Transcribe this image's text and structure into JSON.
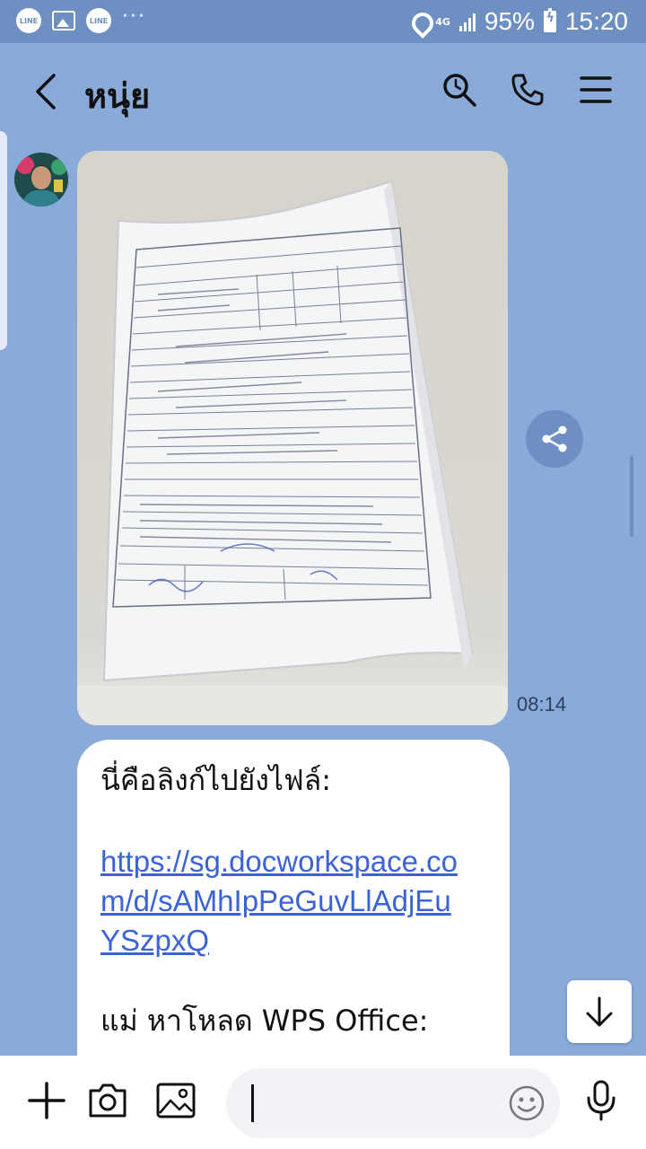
{
  "status_bar": {
    "app_icon_1": "LINE",
    "app_icon_2": "LINE",
    "network": "4G",
    "battery": "95%",
    "time": "15:20"
  },
  "header": {
    "title": "หนุ่ย",
    "icons": [
      "back-icon",
      "search-icon",
      "phone-icon",
      "menu-icon"
    ]
  },
  "messages": [
    {
      "type": "image",
      "sender": "avatar",
      "time": "08:14"
    },
    {
      "type": "text",
      "intro": "นี่คือลิงก์ไปยังไฟล์:",
      "link": "https://sg.docworkspace.com/d/sAMhIpPeGuvLlAdjEuYSzpxQ",
      "footer": "แม่ หาโหลด WPS Office:"
    }
  ],
  "input_bar": {
    "placeholder": "",
    "icons": [
      "plus-icon",
      "camera-icon",
      "image-icon",
      "emoji-icon",
      "mic-icon"
    ]
  },
  "colors": {
    "background": "#8aaad9",
    "status_bar": "#6e8fc2",
    "link": "#3c63d6"
  }
}
